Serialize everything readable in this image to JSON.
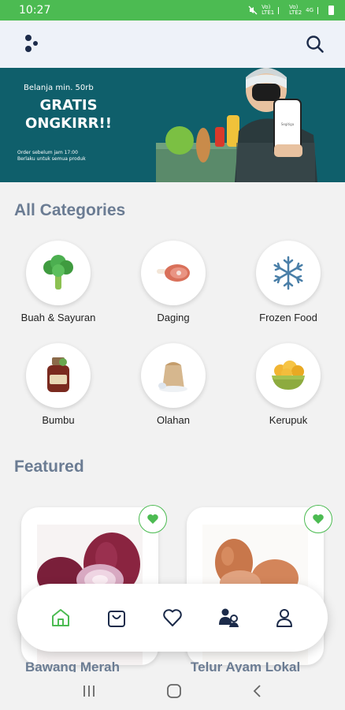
{
  "status_bar": {
    "time": "10:27",
    "net1": "Vo) LTE1",
    "net2": "Vo) LTE2",
    "net3": "4G"
  },
  "banner": {
    "subtitle": "Belanja min. 50rb",
    "headline": "GRATIS ONGKIRR!!",
    "fine_line1": "Order sebelum jam 17:00",
    "fine_line2": "Berlaku untuk semua produk",
    "phone_text": "Segitiga"
  },
  "categories_title": "All Categories",
  "categories": [
    {
      "label": "Buah & Sayuran",
      "icon": "broccoli-icon"
    },
    {
      "label": "Daging",
      "icon": "meat-icon"
    },
    {
      "label": "Frozen Food",
      "icon": "snowflake-icon"
    },
    {
      "label": "Bumbu",
      "icon": "spice-jar-icon"
    },
    {
      "label": "Olahan",
      "icon": "flour-sack-icon"
    },
    {
      "label": "Kerupuk",
      "icon": "crackers-bowl-icon"
    }
  ],
  "featured_title": "Featured",
  "featured": [
    {
      "name": "Bawang Merah",
      "image": "red-onion-image"
    },
    {
      "name": "Telur Ayam Lokal",
      "image": "eggs-image"
    }
  ],
  "colors": {
    "accent": "#4cbb52",
    "title": "#6b7c93",
    "banner": "#0f5f6b",
    "navy": "#1c2b4a"
  },
  "bottom_nav": [
    "home-icon",
    "shopping-bag-icon",
    "heart-icon",
    "community-icon",
    "profile-icon"
  ]
}
